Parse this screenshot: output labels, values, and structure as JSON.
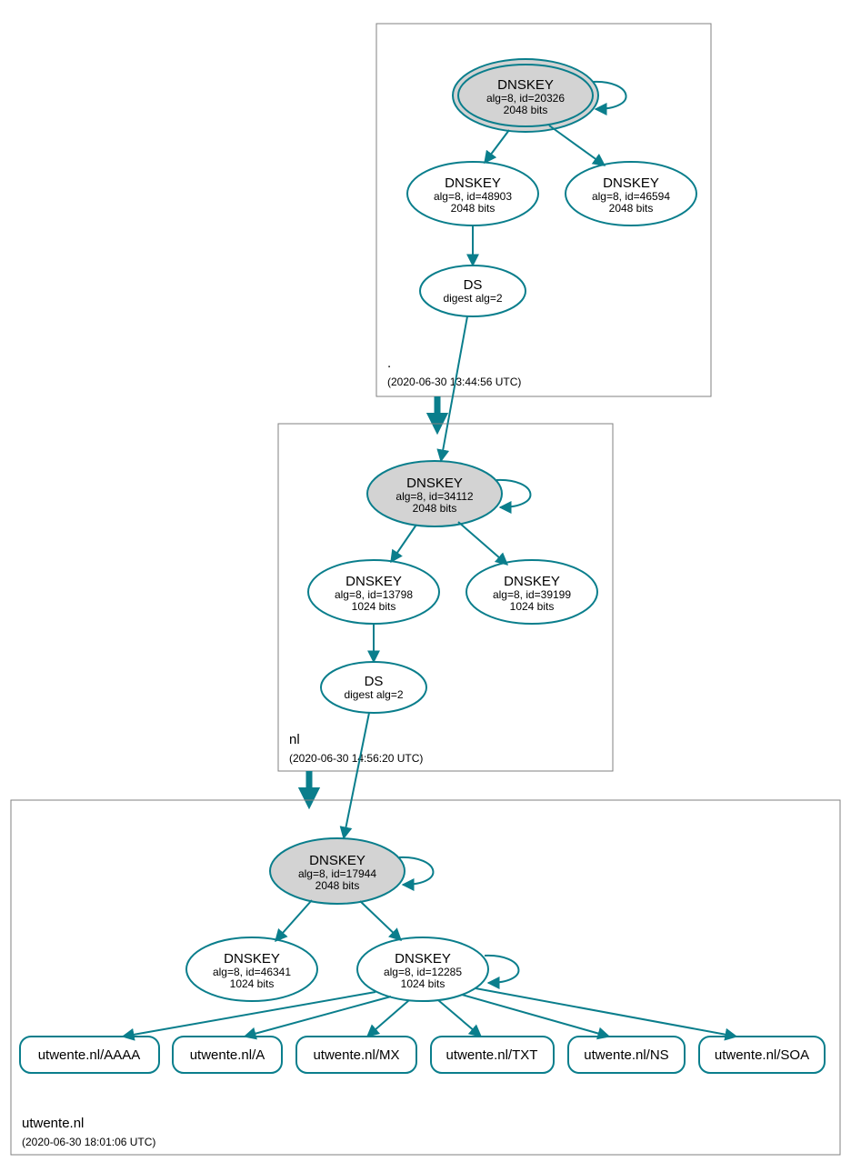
{
  "zones": {
    "root": {
      "label": ".",
      "timestamp": "(2020-06-30 13:44:56 UTC)",
      "nodes": {
        "dnskey_ksk": {
          "title": "DNSKEY",
          "line2": "alg=8, id=20326",
          "line3": "2048 bits"
        },
        "dnskey_zsk1": {
          "title": "DNSKEY",
          "line2": "alg=8, id=48903",
          "line3": "2048 bits"
        },
        "dnskey_zsk2": {
          "title": "DNSKEY",
          "line2": "alg=8, id=46594",
          "line3": "2048 bits"
        },
        "ds": {
          "title": "DS",
          "line2": "digest alg=2"
        }
      }
    },
    "nl": {
      "label": "nl",
      "timestamp": "(2020-06-30 14:56:20 UTC)",
      "nodes": {
        "dnskey_ksk": {
          "title": "DNSKEY",
          "line2": "alg=8, id=34112",
          "line3": "2048 bits"
        },
        "dnskey_zsk1": {
          "title": "DNSKEY",
          "line2": "alg=8, id=13798",
          "line3": "1024 bits"
        },
        "dnskey_zsk2": {
          "title": "DNSKEY",
          "line2": "alg=8, id=39199",
          "line3": "1024 bits"
        },
        "ds": {
          "title": "DS",
          "line2": "digest alg=2"
        }
      }
    },
    "utwente": {
      "label": "utwente.nl",
      "timestamp": "(2020-06-30 18:01:06 UTC)",
      "nodes": {
        "dnskey_ksk": {
          "title": "DNSKEY",
          "line2": "alg=8, id=17944",
          "line3": "2048 bits"
        },
        "dnskey_zsk1": {
          "title": "DNSKEY",
          "line2": "alg=8, id=46341",
          "line3": "1024 bits"
        },
        "dnskey_zsk2": {
          "title": "DNSKEY",
          "line2": "alg=8, id=12285",
          "line3": "1024 bits"
        }
      },
      "records": {
        "aaaa": "utwente.nl/AAAA",
        "a": "utwente.nl/A",
        "mx": "utwente.nl/MX",
        "txt": "utwente.nl/TXT",
        "ns": "utwente.nl/NS",
        "soa": "utwente.nl/SOA"
      }
    }
  }
}
